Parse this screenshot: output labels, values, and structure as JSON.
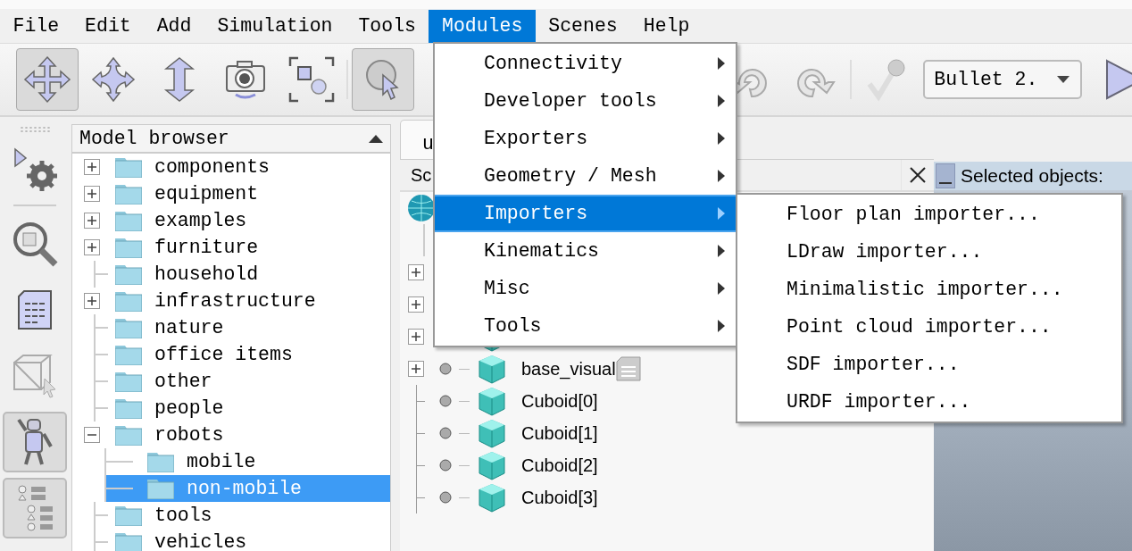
{
  "menubar": [
    {
      "label": "File",
      "selected": false
    },
    {
      "label": "Edit",
      "selected": false
    },
    {
      "label": "Add",
      "selected": false
    },
    {
      "label": "Simulation",
      "selected": false
    },
    {
      "label": "Tools",
      "selected": false
    },
    {
      "label": "Modules",
      "selected": true
    },
    {
      "label": "Scenes",
      "selected": false
    },
    {
      "label": "Help",
      "selected": false
    }
  ],
  "toolbar": {
    "tools": [
      {
        "kind": "move",
        "selected": true
      },
      {
        "kind": "rotate",
        "selected": false
      },
      {
        "kind": "shift",
        "selected": false
      },
      {
        "kind": "camera",
        "selected": false
      },
      {
        "kind": "fit",
        "selected": false
      },
      {
        "kind": "separator"
      },
      {
        "kind": "select",
        "selected": true
      },
      {
        "kind": "undo"
      },
      {
        "kind": "redo"
      },
      {
        "kind": "separator"
      },
      {
        "kind": "check"
      }
    ],
    "engine_dropdown": {
      "value": "Bullet 2."
    }
  },
  "side_toolbar": [
    {
      "kind": "script",
      "selected": false
    },
    {
      "kind": "separator"
    },
    {
      "kind": "zoom",
      "selected": false
    },
    {
      "kind": "document",
      "selected": false
    },
    {
      "kind": "box-pointer",
      "selected": false
    },
    {
      "kind": "robot",
      "selected": true
    },
    {
      "kind": "list",
      "selected": true
    }
  ],
  "model_browser": {
    "title": "Model browser",
    "items": [
      {
        "label": "components",
        "expandable": true,
        "expanded": false,
        "selected": false
      },
      {
        "label": "equipment",
        "expandable": true,
        "expanded": false,
        "selected": false
      },
      {
        "label": "examples",
        "expandable": true,
        "expanded": false,
        "selected": false
      },
      {
        "label": "furniture",
        "expandable": true,
        "expanded": false,
        "selected": false
      },
      {
        "label": "household",
        "expandable": false,
        "selected": false
      },
      {
        "label": "infrastructure",
        "expandable": true,
        "expanded": false,
        "selected": false
      },
      {
        "label": "nature",
        "expandable": false,
        "selected": false
      },
      {
        "label": "office items",
        "expandable": false,
        "selected": false
      },
      {
        "label": "other",
        "expandable": false,
        "selected": false
      },
      {
        "label": "people",
        "expandable": false,
        "selected": false
      },
      {
        "label": "robots",
        "expandable": true,
        "expanded": true,
        "selected": false,
        "children": [
          {
            "label": "mobile",
            "selected": false
          },
          {
            "label": "non-mobile",
            "selected": true
          }
        ]
      },
      {
        "label": "tools",
        "expandable": false,
        "selected": false
      },
      {
        "label": "vehicles",
        "expandable": false,
        "selected": false
      }
    ]
  },
  "scene_panel": {
    "tab": "u",
    "column_header": "Sc",
    "rows": [
      {
        "kind": "world"
      },
      {
        "kind": "branch"
      },
      {
        "kind": "covered",
        "expandable": true
      },
      {
        "kind": "covered",
        "expandable": true
      },
      {
        "kind": "object",
        "expandable": true
      },
      {
        "kind": "object",
        "label": "base_visual",
        "expandable": true,
        "script": true
      },
      {
        "kind": "object",
        "label": "Cuboid[0]",
        "expandable": false,
        "script": false
      },
      {
        "kind": "object",
        "label": "Cuboid[1]",
        "expandable": false,
        "script": false
      },
      {
        "kind": "object",
        "label": "Cuboid[2]",
        "expandable": false,
        "script": false
      },
      {
        "kind": "object",
        "label": "Cuboid[3]",
        "expandable": false,
        "script": false
      }
    ]
  },
  "selected_objects": {
    "title": "Selected objects:"
  },
  "modules_menu": {
    "items": [
      {
        "label": "Connectivity",
        "selected": false
      },
      {
        "label": "Developer tools",
        "selected": false
      },
      {
        "label": "Exporters",
        "selected": false
      },
      {
        "label": "Geometry / Mesh",
        "selected": false
      },
      {
        "label": "Importers",
        "selected": true
      },
      {
        "label": "Kinematics",
        "selected": false
      },
      {
        "label": "Misc",
        "selected": false
      },
      {
        "label": "Tools",
        "selected": false
      }
    ]
  },
  "importers_submenu": {
    "items": [
      "Floor plan importer...",
      "LDraw importer...",
      "Minimalistic importer...",
      "Point cloud importer...",
      "SDF importer...",
      "URDF importer..."
    ]
  }
}
